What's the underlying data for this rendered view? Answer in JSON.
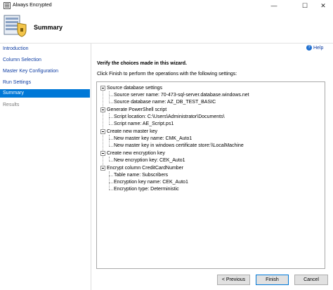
{
  "window": {
    "title": "Always Encrypted",
    "minimize_glyph": "—",
    "maximize_glyph": "☐",
    "close_glyph": "✕"
  },
  "header": {
    "page_title": "Summary",
    "icon": "wizard-shield-icon"
  },
  "sidebar": {
    "items": [
      {
        "label": "Introduction",
        "state": "link"
      },
      {
        "label": "Column Selection",
        "state": "link"
      },
      {
        "label": "Master Key Configuration",
        "state": "link"
      },
      {
        "label": "Run Settings",
        "state": "link"
      },
      {
        "label": "Summary",
        "state": "active"
      },
      {
        "label": "Results",
        "state": "disabled"
      }
    ]
  },
  "help": {
    "label": "Help",
    "icon_glyph": "?"
  },
  "main": {
    "verify_heading": "Verify the choices made in this wizard.",
    "instruction": "Click Finish to perform the operations with the following settings:",
    "tree": [
      {
        "label": "Source database settings",
        "children": [
          "Source server name: 70-473-sql-server.database.windows.net",
          "Source database name: AZ_DB_TEST_BASIC"
        ]
      },
      {
        "label": "Generate PowerShell script",
        "children": [
          "Script location: C:\\Users\\Administrator\\Documents\\",
          "Script name: AE_Script.ps1"
        ]
      },
      {
        "label": "Create new master key",
        "children": [
          "New master key name: CMK_Auto1",
          "New master key in windows certificate store:\\\\LocalMachine"
        ]
      },
      {
        "label": "Create new encryption key",
        "children": [
          "New encryption key: CEK_Auto1"
        ]
      },
      {
        "label": "Encrypt column CreditCardNumber",
        "children": [
          "Table name: Subscribers",
          "Encryption key name: CEK_Auto1",
          "Encryption type: Deterministic"
        ]
      }
    ]
  },
  "footer": {
    "previous_label": "< Previous",
    "finish_label": "Finish",
    "cancel_label": "Cancel"
  },
  "colors": {
    "accent": "#0078d7",
    "link": "#0e3da3"
  }
}
